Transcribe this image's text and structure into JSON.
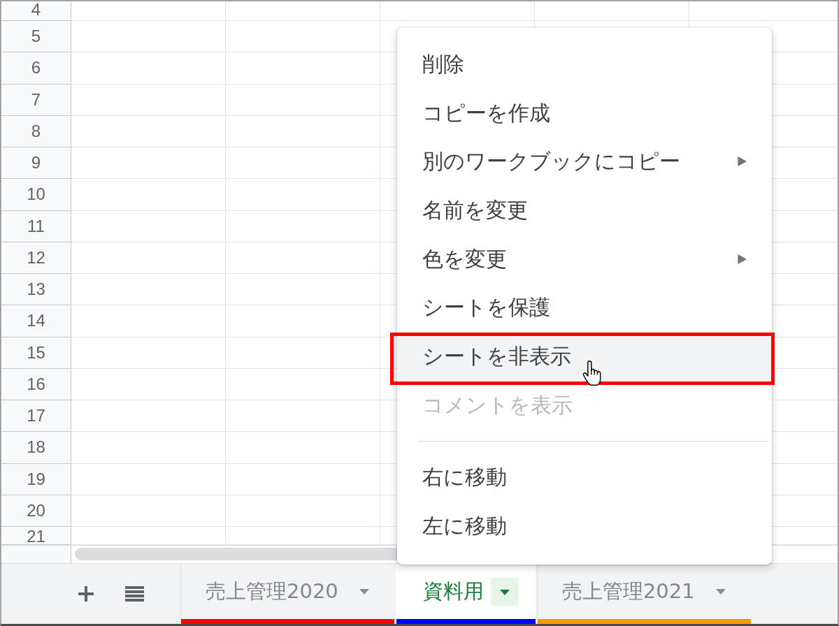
{
  "row_headers": [
    "4",
    "5",
    "6",
    "7",
    "8",
    "9",
    "10",
    "11",
    "12",
    "13",
    "14",
    "15",
    "16",
    "17",
    "18",
    "19",
    "20",
    "21"
  ],
  "context_menu": {
    "items": [
      {
        "kind": "item",
        "label": "削除",
        "submenu": false,
        "disabled": false,
        "hovered": false,
        "outlined": false
      },
      {
        "kind": "item",
        "label": "コピーを作成",
        "submenu": false,
        "disabled": false,
        "hovered": false,
        "outlined": false
      },
      {
        "kind": "item",
        "label": "別のワークブックにコピー",
        "submenu": true,
        "disabled": false,
        "hovered": false,
        "outlined": false
      },
      {
        "kind": "item",
        "label": "名前を変更",
        "submenu": false,
        "disabled": false,
        "hovered": false,
        "outlined": false
      },
      {
        "kind": "item",
        "label": "色を変更",
        "submenu": true,
        "disabled": false,
        "hovered": false,
        "outlined": false
      },
      {
        "kind": "item",
        "label": "シートを保護",
        "submenu": false,
        "disabled": false,
        "hovered": false,
        "outlined": false
      },
      {
        "kind": "item",
        "label": "シートを非表示",
        "submenu": false,
        "disabled": false,
        "hovered": true,
        "outlined": true
      },
      {
        "kind": "item",
        "label": "コメントを表示",
        "submenu": false,
        "disabled": true,
        "hovered": false,
        "outlined": false
      },
      {
        "kind": "separator"
      },
      {
        "kind": "item",
        "label": "右に移動",
        "submenu": false,
        "disabled": false,
        "hovered": false,
        "outlined": false
      },
      {
        "kind": "item",
        "label": "左に移動",
        "submenu": false,
        "disabled": false,
        "hovered": false,
        "outlined": false
      }
    ]
  },
  "sheet_tabs": [
    {
      "label": "売上管理2020",
      "selected": false,
      "color": "#ff0000"
    },
    {
      "label": "資料用",
      "selected": true,
      "color": "#0000ff"
    },
    {
      "label": "売上管理2021",
      "selected": false,
      "color": "#ff9900"
    }
  ]
}
